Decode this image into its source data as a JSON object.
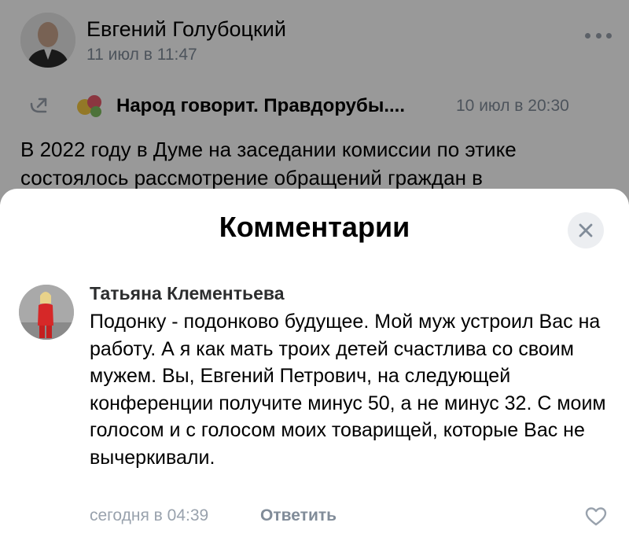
{
  "post": {
    "author": "Евгений Голубоцкий",
    "time": "11 июл в 11:47",
    "more_icon": "more-horizontal-icon",
    "repost": {
      "icon": "repost-arrow-icon",
      "source_name": "Народ говорит. Правдорубы....",
      "time": "10 июл в 20:30"
    },
    "text": "В 2022 году в Думе на заседании комиссии по этике состоялось рассмотрение обращений граждан в"
  },
  "comments_sheet": {
    "title": "Комментарии",
    "close_icon": "close-icon",
    "comment": {
      "author": "Татьяна Клементьева",
      "text": "Подонку - подонково будущее. Мой муж устроил Вас на работу. А я как мать троих детей счастлива со своим мужем. Вы, Евгений Петрович, на следующей конференции получите минус 50, а не минус 32. С моим голосом и с голосом моих товарищей, которые Вас не вычеркивали.",
      "time": "сегодня в 04:39",
      "reply_label": "Ответить",
      "like_icon": "heart-icon"
    }
  },
  "colors": {
    "secondary_text": "#818c99",
    "overlay": "rgba(0,0,0,0.4)",
    "close_bg": "#eceef1"
  }
}
